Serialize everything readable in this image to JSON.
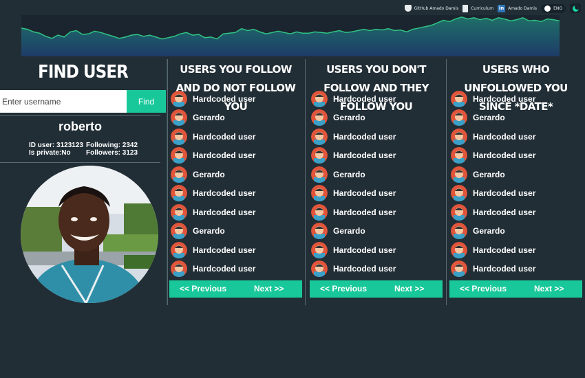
{
  "topbar": {
    "github_label": "GitHub Amado Damis",
    "cv_label": "Curriculum",
    "linkedin_label": "Amado Damis",
    "linkedin_icon_text": "in",
    "language": "ENG"
  },
  "icons": {
    "github": "github-icon",
    "cv": "document-icon",
    "linkedin": "linkedin-icon",
    "theme": "moon-icon"
  },
  "colors": {
    "background": "#222e36",
    "accent": "#19c89a",
    "chart_line": "#2fc483",
    "chart_fill_top": "#1f6f68",
    "chart_fill_bottom": "#1e3c68"
  },
  "banner": {
    "series": [
      44,
      42,
      38,
      36,
      31,
      28,
      33,
      30,
      38,
      40,
      34,
      35,
      39,
      37,
      34,
      31,
      28,
      30,
      33,
      34,
      31,
      33,
      30,
      27,
      29,
      31,
      35,
      37,
      33,
      34,
      29,
      30,
      27,
      35,
      36,
      37,
      43,
      40,
      42,
      38,
      35,
      37,
      39,
      37,
      35,
      38,
      36,
      36,
      38,
      37,
      36,
      38,
      40,
      37,
      38,
      40,
      42,
      40,
      42,
      41,
      43,
      40,
      41,
      38,
      42,
      44,
      46,
      48,
      52,
      56,
      54,
      58,
      61,
      58,
      60,
      57,
      59,
      56,
      60,
      58,
      55,
      57,
      60,
      55,
      56,
      54,
      58,
      57,
      55
    ]
  },
  "search": {
    "title": "FIND USER",
    "placeholder": "Enter username",
    "button_label": "Find"
  },
  "profile": {
    "username": "roberto",
    "id_label": "ID user: 3123123",
    "private_label": "Is private:No",
    "following_label": "Following: 2342",
    "followers_label": "Followers: 3123"
  },
  "panels": [
    {
      "title": "USERS YOU FOLLOW AND DO NOT FOLLOW YOU",
      "users": [
        "Hardcoded user",
        "Gerardo",
        "Hardcoded user",
        "Hardcoded user",
        "Gerardo",
        "Hardcoded user",
        "Hardcoded user",
        "Gerardo",
        "Hardcoded user",
        "Hardcoded user"
      ],
      "prev_label": "<< Previous",
      "next_label": "Next >>"
    },
    {
      "title": "USERS YOU DON'T FOLLOW AND THEY FOLLOW YOU",
      "users": [
        "Hardcoded user",
        "Gerardo",
        "Hardcoded user",
        "Hardcoded user",
        "Gerardo",
        "Hardcoded user",
        "Hardcoded user",
        "Gerardo",
        "Hardcoded user",
        "Hardcoded user"
      ],
      "prev_label": "<< Previous",
      "next_label": "Next >>"
    },
    {
      "title": "USERS WHO UNFOLLOWED YOU SINCE *DATE*",
      "users": [
        "Hardcoded user",
        "Gerardo",
        "Hardcoded user",
        "Hardcoded user",
        "Gerardo",
        "Hardcoded user",
        "Hardcoded user",
        "Gerardo",
        "Hardcoded user",
        "Hardcoded user"
      ],
      "prev_label": "<< Previous",
      "next_label": "Next >>"
    }
  ]
}
